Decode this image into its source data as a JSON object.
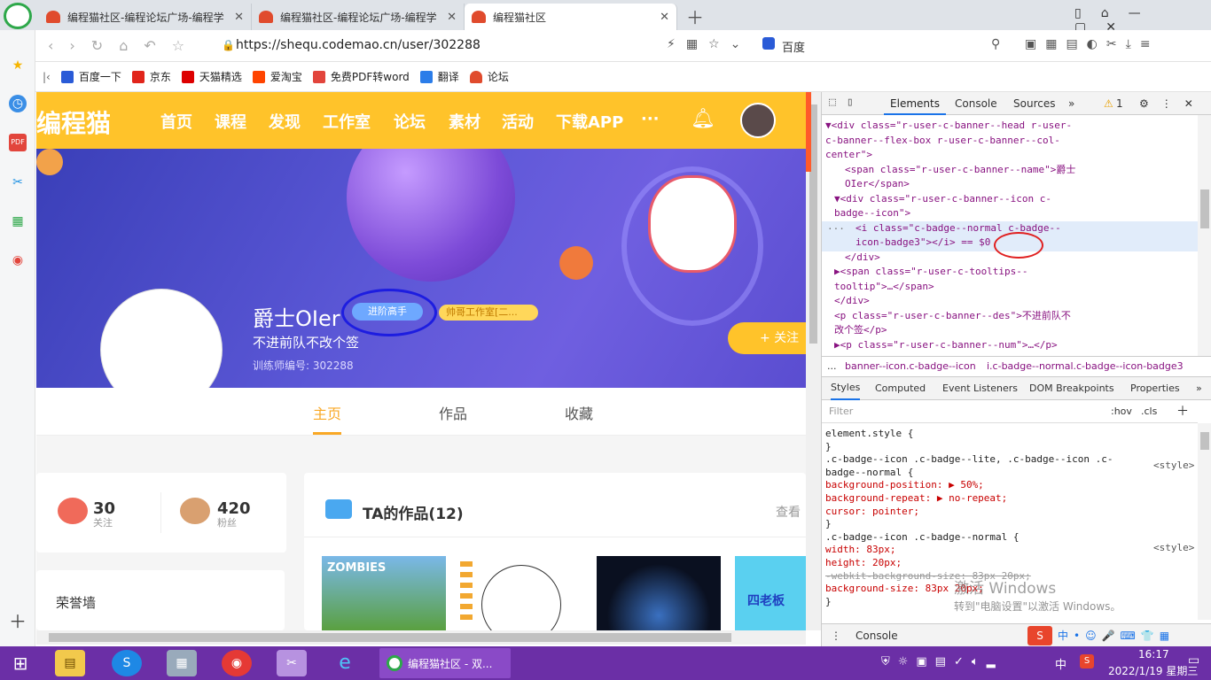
{
  "browser": {
    "tabs": [
      {
        "title": "编程猫社区-编程论坛广场-编程学"
      },
      {
        "title": "编程猫社区-编程论坛广场-编程学"
      },
      {
        "title": "编程猫社区"
      }
    ],
    "url": "https://shequ.codemao.cn/user/302288",
    "search_engine": "百度",
    "bookmarks": [
      "百度一下",
      "京东",
      "天猫精选",
      "爱淘宝",
      "免费PDF转word",
      "翻译",
      "论坛"
    ]
  },
  "site": {
    "logo": "编程猫",
    "nav": [
      "首页",
      "课程",
      "发现",
      "工作室",
      "论坛",
      "素材",
      "活动",
      "下载APP"
    ],
    "more": "···",
    "user_name": "爵士OIer",
    "badge": "进阶高手",
    "studio": "帅哥工作室[二...",
    "signature": "不进前队不改个签",
    "trainer_label": "训练师编号: 302288",
    "follow_btn": "+ 关注",
    "tabs": [
      "主页",
      "作品",
      "收藏"
    ],
    "stats": [
      {
        "value": "30",
        "label": "关注"
      },
      {
        "value": "420",
        "label": "粉丝"
      }
    ],
    "honor_title": "荣誉墙",
    "works_title": "TA的作品(12)",
    "view_more": "查看",
    "work_thumb_1": "ZOMBIES",
    "work_thumb_4": "四老板"
  },
  "devtools": {
    "tabs": [
      "Elements",
      "Console",
      "Sources"
    ],
    "warn_count": "1",
    "breadcrumb": [
      "...",
      "banner--icon.c-badge--icon",
      "i.c-badge--normal.c-badge--icon-badge3"
    ],
    "style_tabs": [
      "Styles",
      "Computed",
      "Event Listeners",
      "DOM Breakpoints",
      "Properties"
    ],
    "filter_placeholder": "Filter",
    "hov": ":hov",
    "cls": ".cls",
    "drawer": "Console",
    "code_lines": [
      {
        "t": "▼<div class=\"r-user-c-banner--head r-user-"
      },
      {
        "t": "c-banner--flex-box r-user-c-banner--col-"
      },
      {
        "t": "center\">"
      },
      {
        "t": "<span class=\"r-user-c-banner--name\">爵士"
      },
      {
        "t": "OIer</span>"
      },
      {
        "t": "▼<div class=\"r-user-c-banner--icon c-"
      },
      {
        "t": "badge--icon\">"
      },
      {
        "t": "<i class=\"c-badge--normal c-badge--"
      },
      {
        "t": "icon-badge3\"></i> == $0"
      },
      {
        "t": "</div>"
      },
      {
        "t": "▶<span class=\"r-user-c-tooltips--"
      },
      {
        "t": "tooltip\">…</span>"
      },
      {
        "t": "</div>"
      },
      {
        "t": "<p class=\"r-user-c-banner--des\">不进前队不"
      },
      {
        "t": "改个签</p>"
      },
      {
        "t": "▶<p class=\"r-user-c-banner--num\">…</p>"
      }
    ],
    "css_lines": [
      {
        "t": "element.style {"
      },
      {
        "t": "}"
      },
      {
        "t": ".c-badge--icon .c-badge--lite, .c-badge--icon .c-"
      },
      {
        "t": "badge--normal {"
      },
      {
        "t": "  background-position: ▶ 50%;"
      },
      {
        "t": "  background-repeat: ▶ no-repeat;"
      },
      {
        "t": "  cursor: pointer;"
      },
      {
        "t": "}"
      },
      {
        "t": ".c-badge--icon .c-badge--normal {"
      },
      {
        "t": "  width: 83px;"
      },
      {
        "t": "  height: 20px;"
      },
      {
        "t": "  -webkit-background-size: 83px 20px;"
      },
      {
        "t": "  background-size: 83px 20px;"
      },
      {
        "t": "}"
      }
    ],
    "style_src": "<style>"
  },
  "watermark": {
    "line1": "激活 Windows",
    "line2": "转到\"电脑设置\"以激活 Windows。"
  },
  "taskbar": {
    "active_window": "编程猫社区 - 双...",
    "time": "16:17",
    "date": "2022/1/19 星期三",
    "ime": "中"
  },
  "colors": {
    "brand": "#ffc32a",
    "nav_active": "#f9a825",
    "banner": "#5b57d6",
    "taskbar": "#6b2fa6"
  }
}
